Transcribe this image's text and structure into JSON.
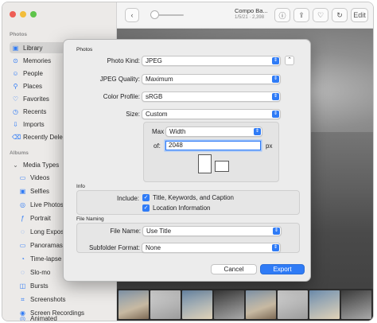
{
  "sidebar": {
    "photos_heading": "Photos",
    "items": [
      {
        "label": "Library",
        "icon": "library-icon"
      },
      {
        "label": "Memories",
        "icon": "memories-icon"
      },
      {
        "label": "People",
        "icon": "people-icon"
      },
      {
        "label": "Places",
        "icon": "places-icon"
      },
      {
        "label": "Favorites",
        "icon": "heart-icon"
      },
      {
        "label": "Recents",
        "icon": "clock-icon"
      },
      {
        "label": "Imports",
        "icon": "import-icon"
      },
      {
        "label": "Recently Dele",
        "icon": "trash-icon"
      }
    ],
    "albums_heading": "Albums",
    "media_types_label": "Media Types",
    "media_items": [
      {
        "label": "Videos",
        "icon": "video-icon"
      },
      {
        "label": "Selfies",
        "icon": "selfie-icon"
      },
      {
        "label": "Live Photos",
        "icon": "live-photo-icon"
      },
      {
        "label": "Portrait",
        "icon": "portrait-icon"
      },
      {
        "label": "Long Expos",
        "icon": "long-exposure-icon"
      },
      {
        "label": "Panoramas",
        "icon": "panorama-icon"
      },
      {
        "label": "Time-lapse",
        "icon": "timelapse-icon"
      },
      {
        "label": "Slo-mo",
        "icon": "slomo-icon"
      },
      {
        "label": "Bursts",
        "icon": "burst-icon"
      },
      {
        "label": "Screenshots",
        "icon": "screenshot-icon"
      },
      {
        "label": "Screen Recordings",
        "icon": "screen-recording-icon"
      },
      {
        "label": "Animated",
        "icon": "animated-icon"
      }
    ]
  },
  "toolbar": {
    "doc_title": "Compo Ba...",
    "doc_subtitle": "1/5/21 · 2,398",
    "edit_label": "Edit"
  },
  "dialog": {
    "photos_group_label": "Photos",
    "photo_kind_label": "Photo Kind:",
    "photo_kind_value": "JPEG",
    "jpeg_quality_label": "JPEG Quality:",
    "jpeg_quality_value": "Maximum",
    "color_profile_label": "Color Profile:",
    "color_profile_value": "sRGB",
    "size_label": "Size:",
    "size_value": "Custom",
    "max_label": "Max",
    "max_value": "Width",
    "of_label": "of:",
    "of_value": "2048",
    "unit_label": "px",
    "info_group_label": "Info",
    "include_label": "Include:",
    "include_title_keywords": "Title, Keywords, and Caption",
    "include_location": "Location Information",
    "naming_group_label": "File Naming",
    "file_name_label": "File Name:",
    "file_name_value": "Use Title",
    "subfolder_label": "Subfolder Format:",
    "subfolder_value": "None",
    "cancel_label": "Cancel",
    "export_label": "Export"
  },
  "colors": {
    "accent": "#2f7bf6",
    "sidebar_bg": "#eceae8",
    "dialog_bg": "#ececec"
  }
}
